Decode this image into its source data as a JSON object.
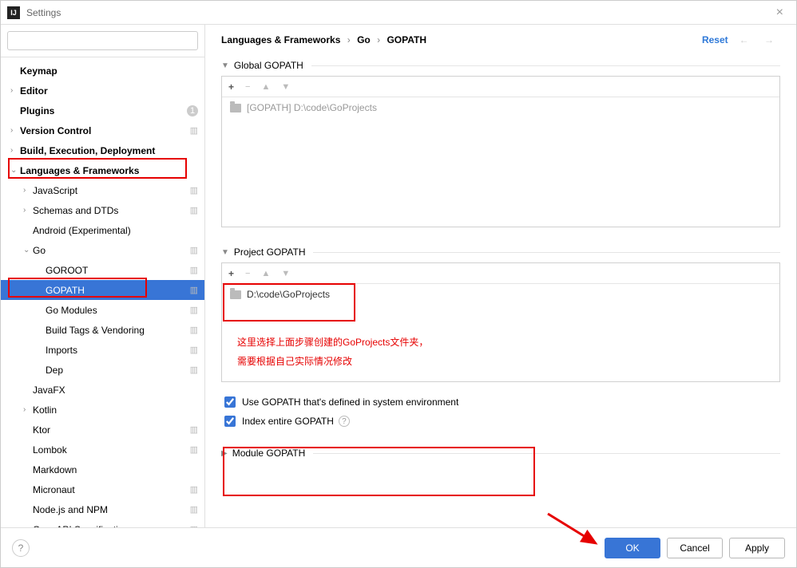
{
  "window": {
    "title": "Settings"
  },
  "search": {
    "placeholder": ""
  },
  "sidebar": {
    "items": [
      {
        "label": "Keymap",
        "arrow": "",
        "indent": 0,
        "bold": true
      },
      {
        "label": "Editor",
        "arrow": "›",
        "indent": 0,
        "bold": true
      },
      {
        "label": "Plugins",
        "arrow": "",
        "indent": 0,
        "bold": true,
        "badge": "1"
      },
      {
        "label": "Version Control",
        "arrow": "›",
        "indent": 0,
        "bold": true,
        "gear": true
      },
      {
        "label": "Build, Execution, Deployment",
        "arrow": "›",
        "indent": 0,
        "bold": true
      },
      {
        "label": "Languages & Frameworks",
        "arrow": "⌄",
        "indent": 0,
        "bold": true
      },
      {
        "label": "JavaScript",
        "arrow": "›",
        "indent": 1,
        "gear": true
      },
      {
        "label": "Schemas and DTDs",
        "arrow": "›",
        "indent": 1,
        "gear": true
      },
      {
        "label": "Android (Experimental)",
        "arrow": "",
        "indent": 1
      },
      {
        "label": "Go",
        "arrow": "⌄",
        "indent": 1,
        "gear": true
      },
      {
        "label": "GOROOT",
        "arrow": "",
        "indent": 2,
        "gear": true
      },
      {
        "label": "GOPATH",
        "arrow": "",
        "indent": 2,
        "gear": true,
        "selected": true
      },
      {
        "label": "Go Modules",
        "arrow": "",
        "indent": 2,
        "gear": true
      },
      {
        "label": "Build Tags & Vendoring",
        "arrow": "",
        "indent": 2,
        "gear": true
      },
      {
        "label": "Imports",
        "arrow": "",
        "indent": 2,
        "gear": true
      },
      {
        "label": "Dep",
        "arrow": "",
        "indent": 2,
        "gear": true
      },
      {
        "label": "JavaFX",
        "arrow": "",
        "indent": 1
      },
      {
        "label": "Kotlin",
        "arrow": "›",
        "indent": 1
      },
      {
        "label": "Ktor",
        "arrow": "",
        "indent": 1,
        "gear": true
      },
      {
        "label": "Lombok",
        "arrow": "",
        "indent": 1,
        "gear": true
      },
      {
        "label": "Markdown",
        "arrow": "",
        "indent": 1
      },
      {
        "label": "Micronaut",
        "arrow": "",
        "indent": 1,
        "gear": true
      },
      {
        "label": "Node.js and NPM",
        "arrow": "",
        "indent": 1,
        "gear": true
      },
      {
        "label": "OpenAPI Specifications",
        "arrow": "",
        "indent": 1,
        "gear": true
      }
    ]
  },
  "breadcrumb": {
    "p1": "Languages & Frameworks",
    "p2": "Go",
    "p3": "GOPATH"
  },
  "reset": "Reset",
  "sections": {
    "global": {
      "title": "Global GOPATH",
      "entry": "[GOPATH] D:\\code\\GoProjects"
    },
    "project": {
      "title": "Project GOPATH",
      "entry": "D:\\code\\GoProjects"
    },
    "module": {
      "title": "Module GOPATH"
    }
  },
  "checks": {
    "use_system": "Use GOPATH that's defined in system environment",
    "index_entire": "Index entire GOPATH"
  },
  "footer": {
    "ok": "OK",
    "cancel": "Cancel",
    "apply": "Apply"
  },
  "annotation": {
    "line1": "这里选择上面步骤创建的GoProjects文件夹，",
    "line2": "需要根据自己实际情况修改"
  }
}
